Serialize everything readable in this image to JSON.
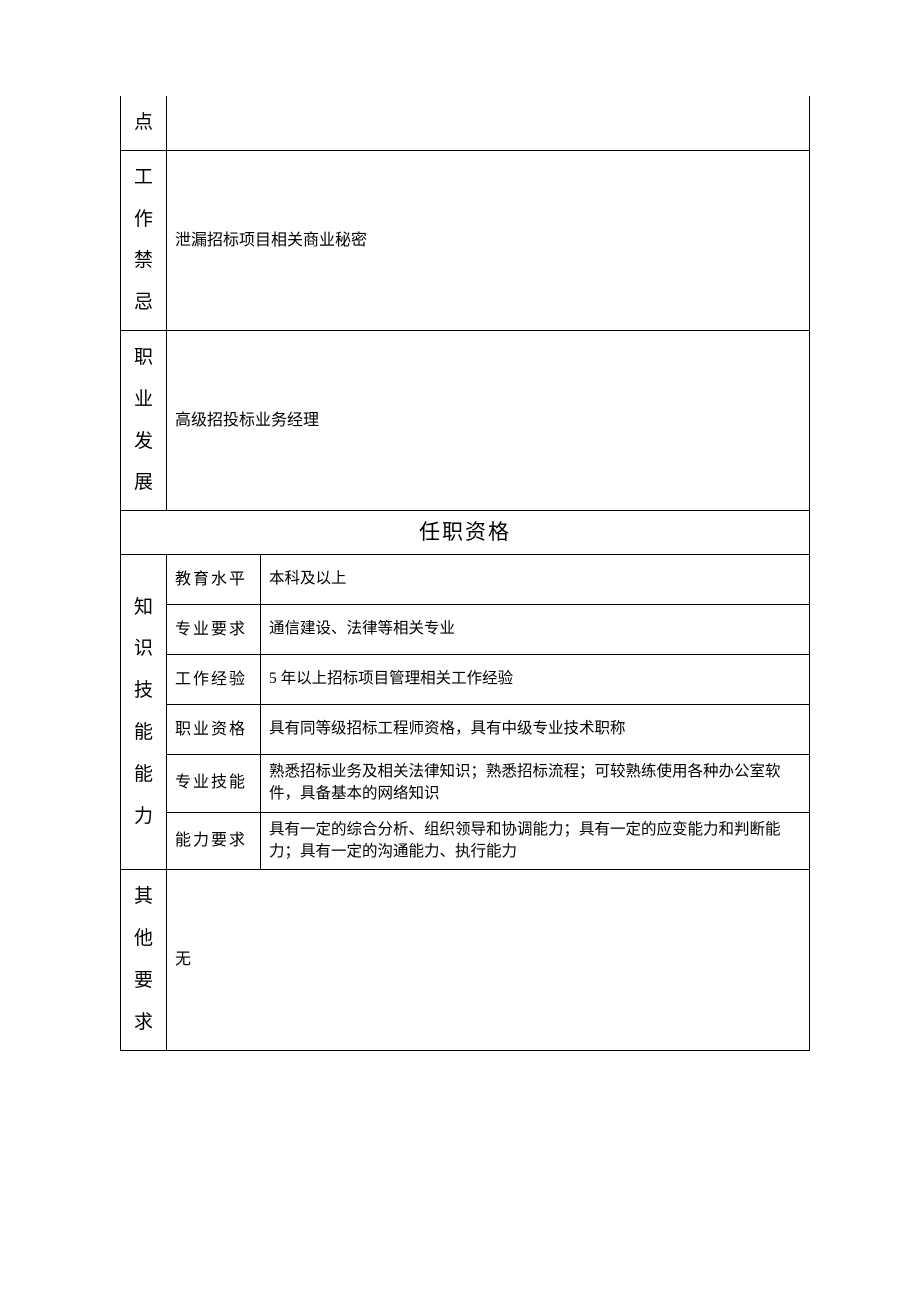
{
  "rows": {
    "r0_label": "点",
    "r1_label_chars": [
      "工",
      "作",
      "禁",
      "忌"
    ],
    "r1_value": "泄漏招标项目相关商业秘密",
    "r2_label_chars": [
      "职",
      "业",
      "发",
      "展"
    ],
    "r2_value": "高级招投标业务经理",
    "section_header": "任职资格",
    "qual_vertical_chars": [
      "知",
      "识",
      "技",
      "能",
      "能",
      "力"
    ],
    "qual": [
      {
        "label": "教育水平",
        "value": "本科及以上"
      },
      {
        "label": "专业要求",
        "value": "通信建设、法律等相关专业"
      },
      {
        "label": "工作经验",
        "value": "5 年以上招标项目管理相关工作经验"
      },
      {
        "label": "职业资格",
        "value": "具有同等级招标工程师资格，具有中级专业技术职称"
      },
      {
        "label": "专业技能",
        "value": "熟悉招标业务及相关法律知识；熟悉招标流程；可较熟练使用各种办公室软件，具备基本的网络知识"
      },
      {
        "label": "能力要求",
        "value": "具有一定的综合分析、组织领导和协调能力；具有一定的应变能力和判断能力；具有一定的沟通能力、执行能力"
      }
    ],
    "other_label_chars": [
      "其",
      "他",
      "要",
      "求"
    ],
    "other_value": "无"
  }
}
